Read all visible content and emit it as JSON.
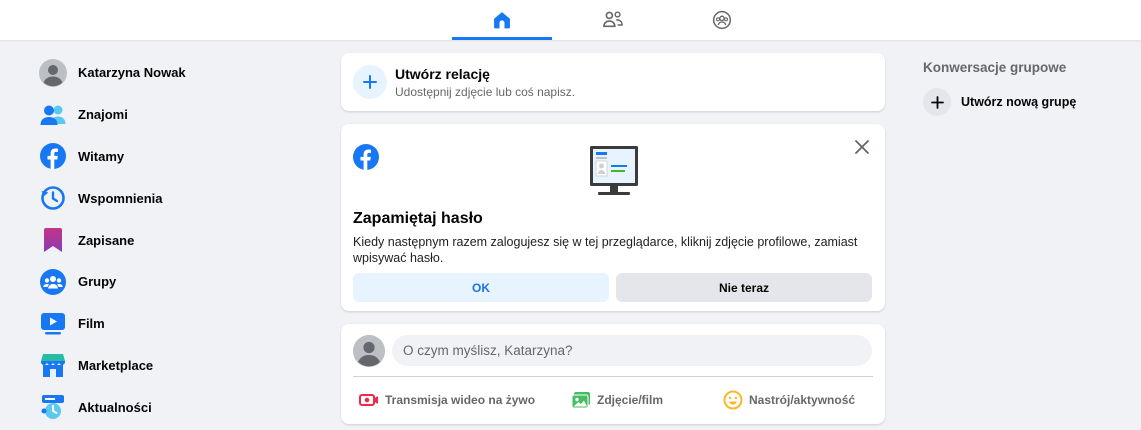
{
  "nav": {
    "tabs": [
      {
        "icon": "home-icon",
        "active": true
      },
      {
        "icon": "friends-icon",
        "active": false
      },
      {
        "icon": "groups-icon",
        "active": false
      }
    ]
  },
  "sidebar": {
    "items": [
      {
        "label": "Katarzyna Nowak",
        "icon": "avatar"
      },
      {
        "label": "Znajomi",
        "icon": "friends-icon"
      },
      {
        "label": "Witamy",
        "icon": "facebook-icon"
      },
      {
        "label": "Wspomnienia",
        "icon": "memories-clock-icon"
      },
      {
        "label": "Zapisane",
        "icon": "bookmark-icon"
      },
      {
        "label": "Grupy",
        "icon": "groups-icon"
      },
      {
        "label": "Film",
        "icon": "video-icon"
      },
      {
        "label": "Marketplace",
        "icon": "marketplace-icon"
      },
      {
        "label": "Aktualności",
        "icon": "news-feed-icon"
      }
    ]
  },
  "story": {
    "title": "Utwórz relację",
    "subtitle": "Udostępnij zdjęcie lub coś napisz."
  },
  "remember": {
    "title": "Zapamiętaj hasło",
    "text": "Kiedy następnym razem zalogujesz się w tej przeglądarce, kliknij zdjęcie profilowe, zamiast wpisywać hasło.",
    "ok_label": "OK",
    "not_now_label": "Nie teraz"
  },
  "composer": {
    "placeholder": "O czym myślisz, Katarzyna?",
    "actions": [
      {
        "label": "Transmisja wideo na żywo",
        "icon": "live-video-icon"
      },
      {
        "label": "Zdjęcie/film",
        "icon": "photo-icon"
      },
      {
        "label": "Nastrój/aktywność",
        "icon": "feeling-icon"
      }
    ]
  },
  "right": {
    "title": "Konwersacje grupowe",
    "create_label": "Utwórz nową grupę"
  },
  "colors": {
    "accent": "#1877f2",
    "background": "#f0f2f5"
  }
}
